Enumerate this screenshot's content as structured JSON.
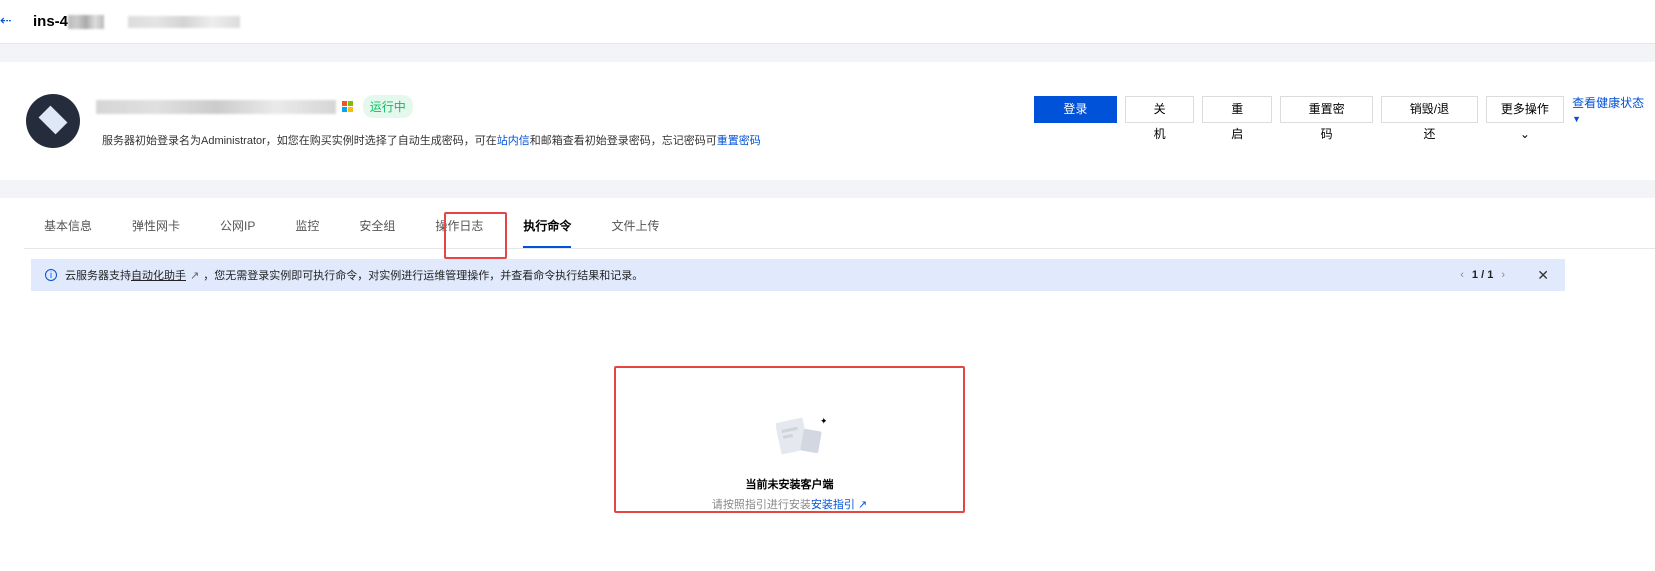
{
  "header": {
    "back_icon": "arrow-left-icon",
    "instance_id_prefix": "ins-4"
  },
  "instance": {
    "status": "运行中",
    "os_icon": "windows-icon",
    "desc_before": "服务器初始登录名为Administrator，如您在购买实例时选择了自动生成密码，可在",
    "desc_link1": "站内信",
    "desc_mid": "和邮箱查看初始登录密码，忘记密码可",
    "desc_link2": "重置密码"
  },
  "actions": {
    "login": "登录",
    "shutdown": "关机",
    "restart": "重启",
    "reset_password": "重置密码",
    "destroy": "销毁/退还",
    "more": "更多操作",
    "health": "查看健康状态"
  },
  "tabs": [
    "基本信息",
    "弹性网卡",
    "公网IP",
    "监控",
    "安全组",
    "操作日志",
    "执行命令",
    "文件上传"
  ],
  "banner": {
    "before": "云服务器支持",
    "link": "自动化助手",
    "after": "，您无需登录实例即可执行命令，对实例进行运维管理操作，并查看命令执行结果和记录。",
    "pager": "1 / 1"
  },
  "empty": {
    "title": "当前未安装客户端",
    "hint": "请按照指引进行安装",
    "link": "安装指引"
  },
  "colors": {
    "primary": "#0052d9",
    "running": "#0abf5b",
    "highlight": "#e54545"
  }
}
